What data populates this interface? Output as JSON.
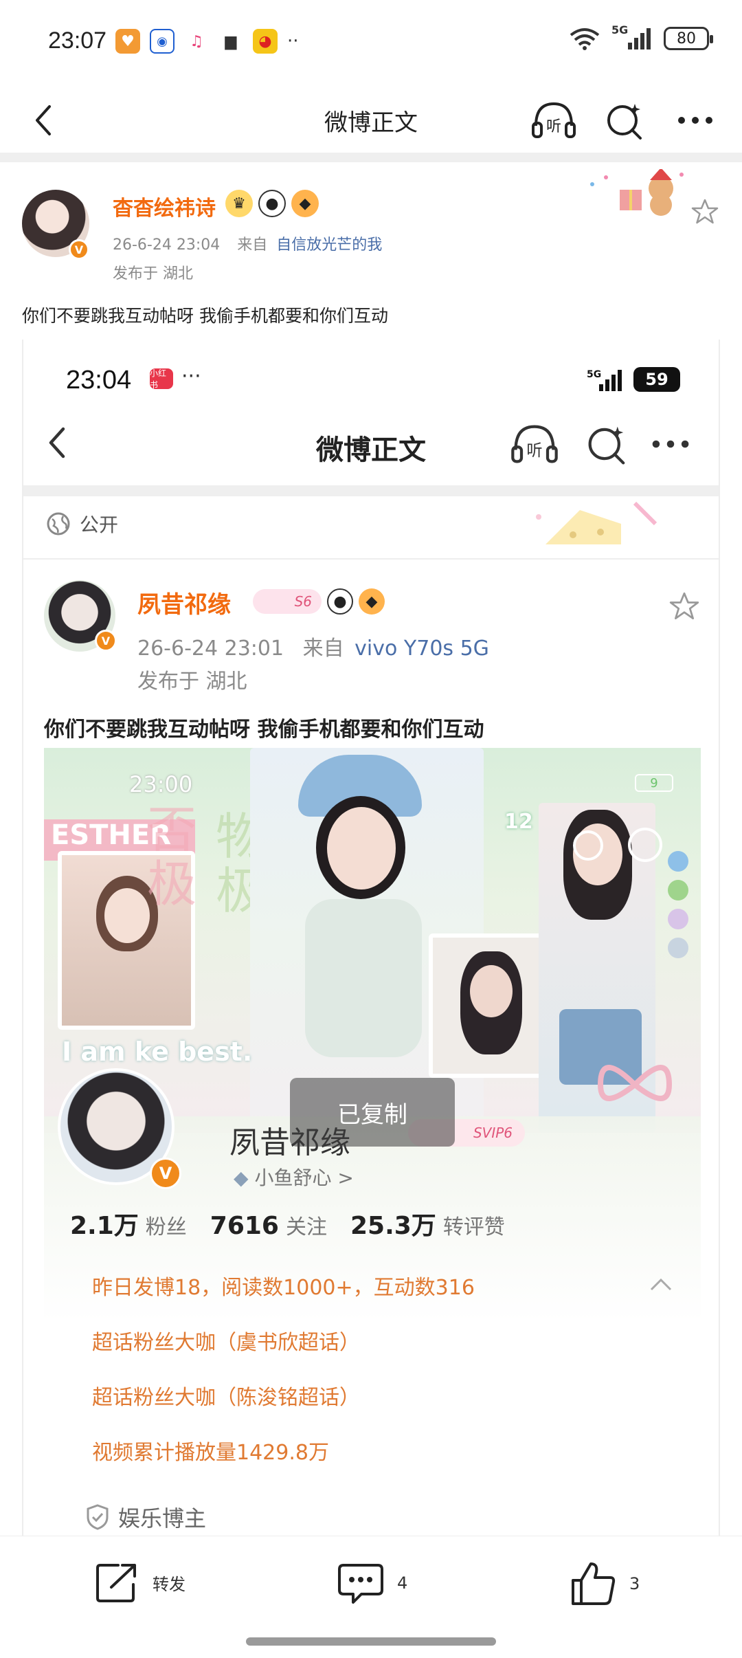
{
  "status_bar": {
    "time": "23:07",
    "battery": "80",
    "network": "5G"
  },
  "nav": {
    "title": "微博正文"
  },
  "post": {
    "username": "杳杳绘祎诗",
    "date": "26-6-24 23:04",
    "source_prefix": "来自",
    "source": "自信放光芒的我",
    "location": "发布于 湖北",
    "text": "你们不要跳我互动帖呀 我偷手机都要和你们互动"
  },
  "embedded": {
    "status_time": "23:04",
    "status_dots": "···",
    "app_badge": "小红书",
    "battery": "59",
    "nav_title": "微博正文",
    "visibility": "公开",
    "username": "夙昔祁缘",
    "level_badge": "S6",
    "date": "26-6-24 23:01",
    "source_prefix": "来自",
    "source": "vivo Y70s 5G",
    "location": "发布于 湖北",
    "text": "你们不要跳我互动帖呀 我偷手机都要和你们互动",
    "photo_time": "23:00",
    "photo_battery": "9",
    "photo_text_en": "I am    ke best.",
    "photo_number": "12",
    "photo_banner": "ESTHER",
    "toast": "已复制",
    "profile": {
      "name": "夙昔祁缘",
      "svip": "SVIP6",
      "fish_link": "小鱼舒心 >",
      "stats": [
        {
          "num": "2.1万",
          "label": "粉丝"
        },
        {
          "num": "7616",
          "label": "关注"
        },
        {
          "num": "25.3万",
          "label": "转评赞"
        }
      ],
      "info": [
        "昨日发博18，阅读数1000+，互动数316",
        "超话粉丝大咖（虞书欣超话）",
        "超话粉丝大咖（陈浚铭超话）",
        "视频累计播放量1429.8万"
      ],
      "role": "娱乐博主"
    }
  },
  "actions": {
    "repost_label": "转发",
    "comment_count": "4",
    "like_count": "3"
  },
  "colors": {
    "accent_orange": "#f26a0f",
    "link_blue": "#4a6ea8",
    "info_orange": "#e07a32"
  }
}
